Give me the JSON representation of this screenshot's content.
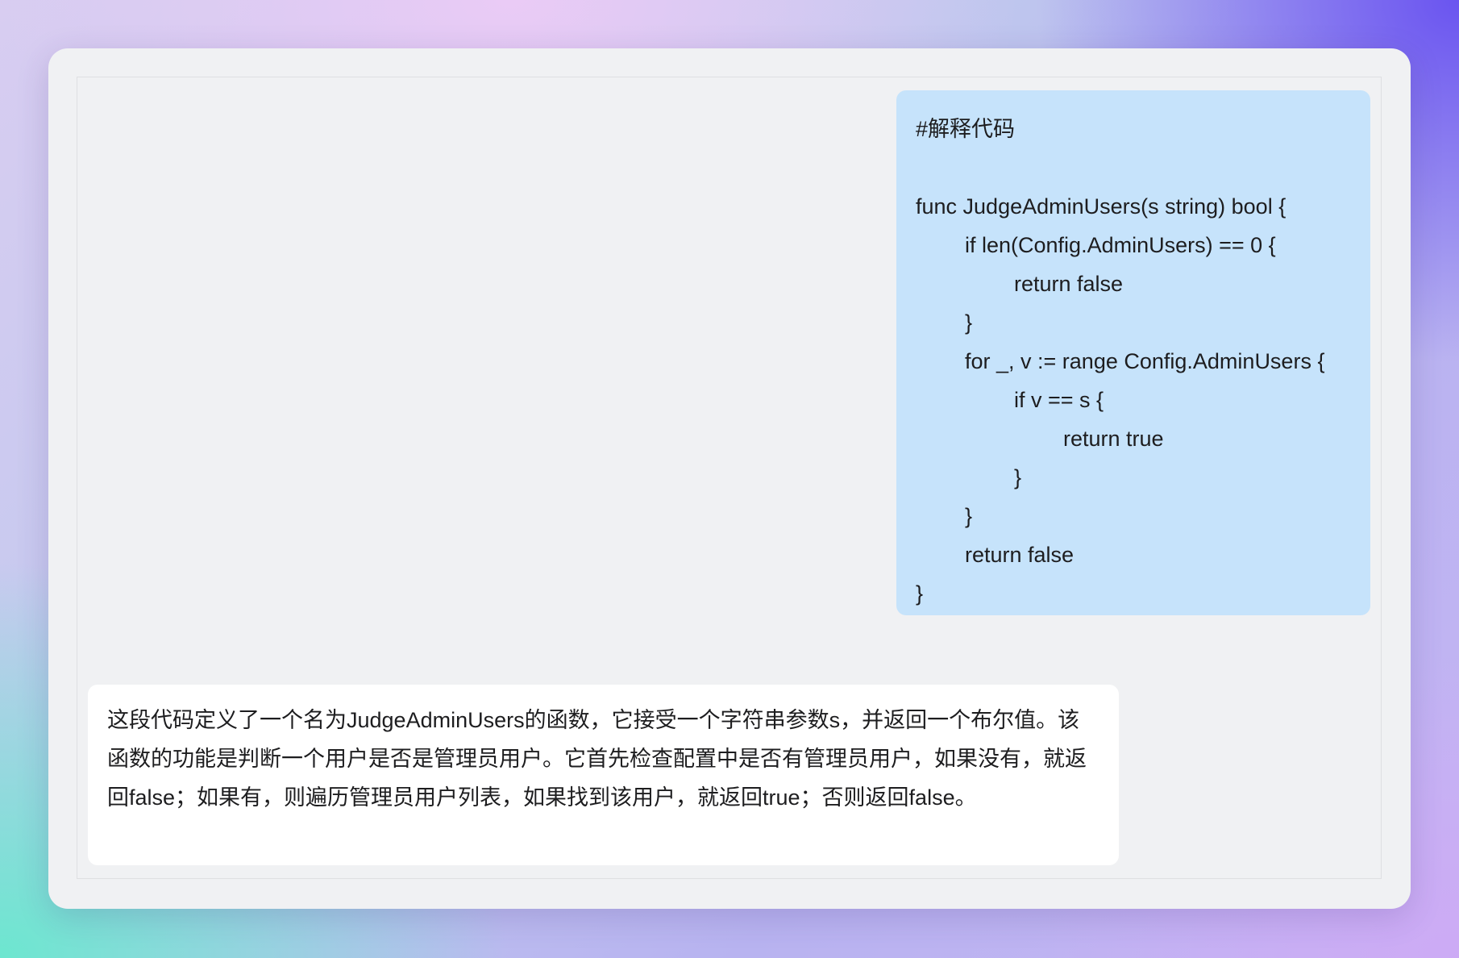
{
  "conversation": {
    "user_message": {
      "lines": [
        "#解释代码",
        "",
        "func JudgeAdminUsers(s string) bool {",
        "\tif len(Config.AdminUsers) == 0 {",
        "\t\treturn false",
        "\t}",
        "\tfor _, v := range Config.AdminUsers {",
        "\t\tif v == s {",
        "\t\t\treturn true",
        "\t\t}",
        "\t}",
        "\treturn false",
        "}"
      ]
    },
    "assistant_message": {
      "text": "这段代码定义了一个名为JudgeAdminUsers的函数，它接受一个字符串参数s，并返回一个布尔值。该函数的功能是判断一个用户是否是管理员用户。它首先检查配置中是否有管理员用户，如果没有，就返回false；如果有，则遍历管理员用户列表，如果找到该用户，就返回true；否则返回false。"
    }
  },
  "colors": {
    "user_bubble": "#c6e3fb",
    "assistant_bubble": "#ffffff",
    "panel": "#f0f1f3",
    "text": "#1d1d1f"
  }
}
